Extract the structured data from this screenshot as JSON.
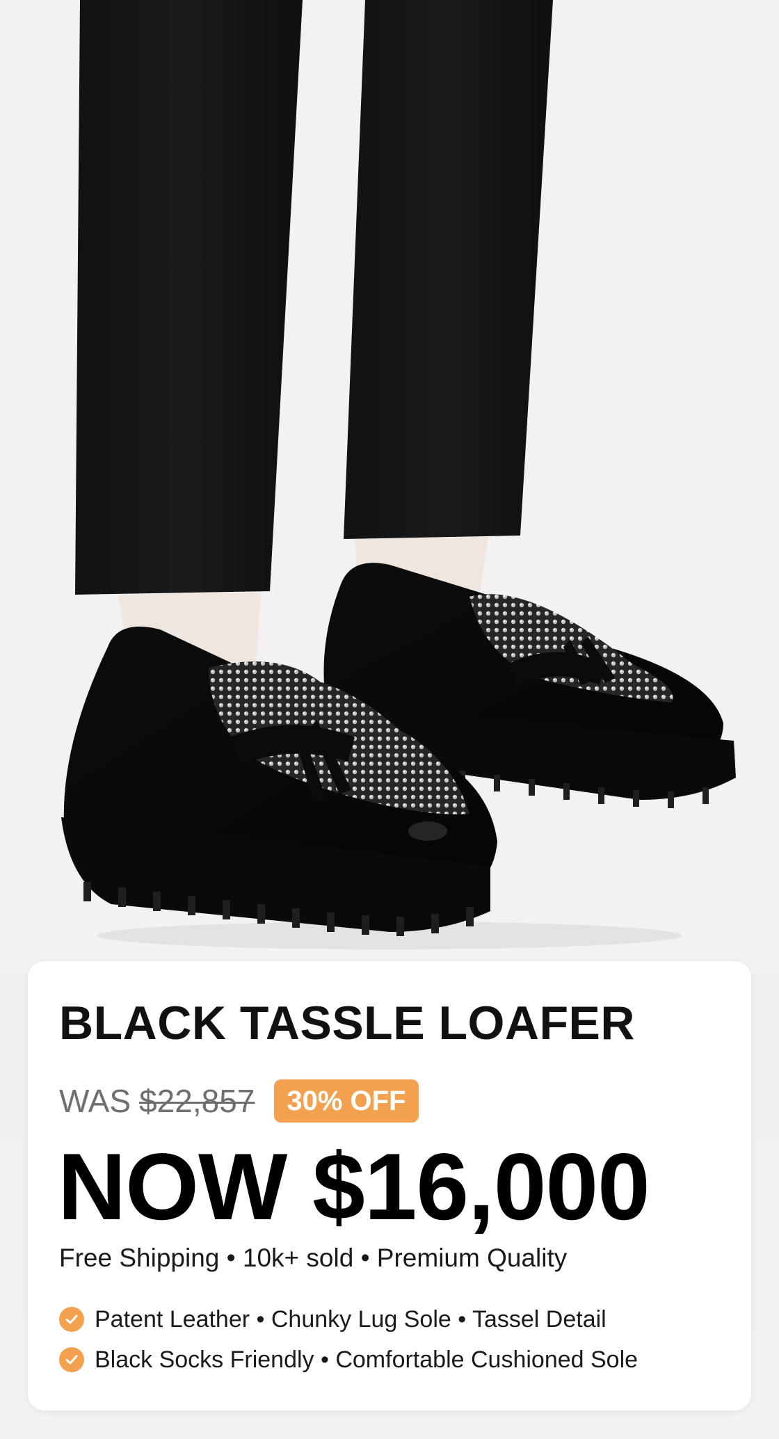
{
  "product": {
    "title": "BLACK TASSLE LOAFER",
    "was_label": "WAS",
    "was_price": "$22,857",
    "discount_badge": "30% OFF",
    "now_price": "NOW $16,000",
    "meta": "Free Shipping • 10k+ sold • Premium Quality",
    "features": [
      "Patent Leather • Chunky Lug Sole • Tassel Detail",
      "Black Socks Friendly • Comfortable Cushioned Sole"
    ]
  },
  "colors": {
    "accent": "#f3a04f",
    "title": "#111111",
    "muted": "#6f6f6f",
    "card_background": "#ffffff",
    "page_background": "#f1f1f1"
  },
  "icons": {
    "feature_icon": "check-circle-icon"
  }
}
